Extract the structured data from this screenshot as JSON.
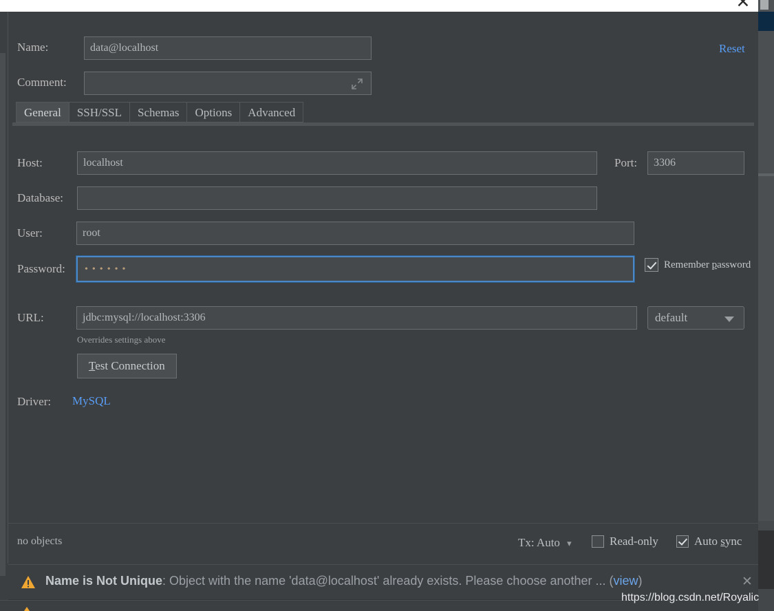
{
  "window": {
    "close_icon": "close-x-icon"
  },
  "header": {
    "name_label": "Name:",
    "name_value": "data@localhost",
    "comment_label": "Comment:",
    "comment_value": "",
    "comment_expand_icon": "expand-diagonal-icon",
    "reset_label": "Reset"
  },
  "tabs": [
    {
      "label": "General",
      "active": true
    },
    {
      "label": "SSH/SSL",
      "active": false
    },
    {
      "label": "Schemas",
      "active": false
    },
    {
      "label": "Options",
      "active": false
    },
    {
      "label": "Advanced",
      "active": false
    }
  ],
  "general": {
    "host_label": "Host:",
    "host_value": "localhost",
    "port_label": "Port:",
    "port_value": "3306",
    "database_label": "Database:",
    "database_value": "",
    "user_label": "User:",
    "user_value": "root",
    "password_label": "Password:",
    "password_value": "••••••",
    "password_focused": true,
    "remember_password_pre": "Remember ",
    "remember_password_mnemonic": "p",
    "remember_password_post": "assword",
    "remember_password_checked": true,
    "url_label": "URL:",
    "url_value": "jdbc:mysql://localhost:3306",
    "url_hint": "Overrides settings above",
    "schema_select_value": "default",
    "schema_select_caret_icon": "chevron-down-icon",
    "test_connection_mnemonic": "T",
    "test_connection_rest": "est Connection",
    "driver_label": "Driver:",
    "driver_value": "MySQL"
  },
  "status_bar": {
    "objects_text": "no objects",
    "tx_label": "Tx: Auto",
    "tx_caret_icon": "chevron-down-icon",
    "read_only_label": "Read-only",
    "read_only_checked": false,
    "auto_sync_mnemonic": "s",
    "auto_sync_pre": "Auto ",
    "auto_sync_post": "ync",
    "auto_sync_checked": true
  },
  "warning": {
    "icon": "warning-triangle-icon",
    "title": "Name is Not Unique",
    "message": ": Object with the name 'data@localhost' already exists. Please choose another ... (",
    "view_link": "view",
    "message_tail": ")",
    "close_icon": "close-icon",
    "accent_color": "#f0a732"
  },
  "watermark": {
    "text": "https://blog.csdn.net/Royalic"
  }
}
